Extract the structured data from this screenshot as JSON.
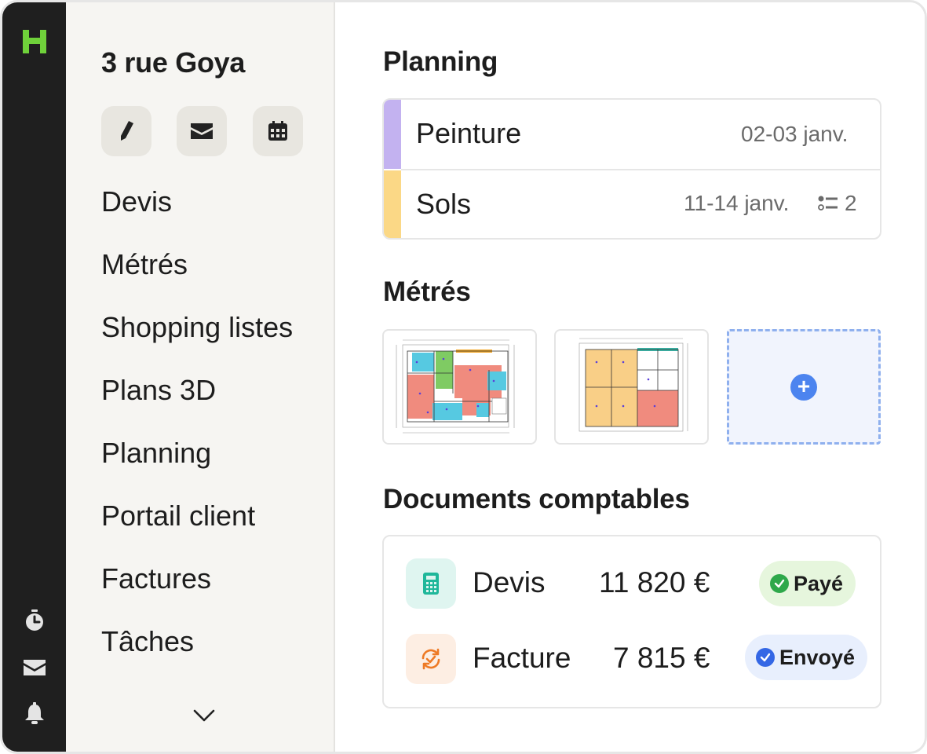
{
  "project": {
    "title": "3 rue Goya"
  },
  "quick_actions": [
    {
      "icon": "pencil-icon"
    },
    {
      "icon": "mail-icon"
    },
    {
      "icon": "calendar-icon"
    }
  ],
  "nav": {
    "items": [
      {
        "label": "Devis"
      },
      {
        "label": "Métrés"
      },
      {
        "label": "Shopping listes"
      },
      {
        "label": "Plans 3D"
      },
      {
        "label": "Planning"
      },
      {
        "label": "Portail client"
      },
      {
        "label": "Factures"
      },
      {
        "label": "Tâches"
      }
    ],
    "more_icon": "chevron-down-icon"
  },
  "rail": {
    "icons": [
      "logo-icon",
      "timer-icon",
      "inbox-icon",
      "bell-icon"
    ]
  },
  "planning": {
    "heading": "Planning",
    "rows": [
      {
        "name": "Peinture",
        "dates": "02-03 janv.",
        "color": "#c3b2f0"
      },
      {
        "name": "Sols",
        "dates": "11-14 janv.",
        "task_count": "2",
        "color": "#fbd886"
      }
    ]
  },
  "metres": {
    "heading": "Métrés",
    "plans": [
      {
        "icon": "floor-plan-thumbnail"
      },
      {
        "icon": "floor-plan-thumbnail"
      }
    ],
    "add_icon": "plus-icon"
  },
  "documents": {
    "heading": "Documents comptables",
    "rows": [
      {
        "name": "Devis",
        "amount": "11 820 €",
        "status": "Payé",
        "icon": "calculator-icon",
        "icon_bg": "#dff5f0",
        "icon_color": "#1fb79a",
        "badge_bg": "#e6f6dd",
        "badge_dot": "#2ea84a"
      },
      {
        "name": "Facture",
        "amount": "7 815 €",
        "status": "Envoyé",
        "icon": "refresh-check-icon",
        "icon_bg": "#fdeee3",
        "icon_color": "#ee7a25",
        "badge_bg": "#e8effd",
        "badge_dot": "#3467e5"
      }
    ]
  },
  "colors": {
    "rail": "#1f1f1f",
    "brand": "#6fd13a",
    "sidebar": "#f6f5f2"
  }
}
